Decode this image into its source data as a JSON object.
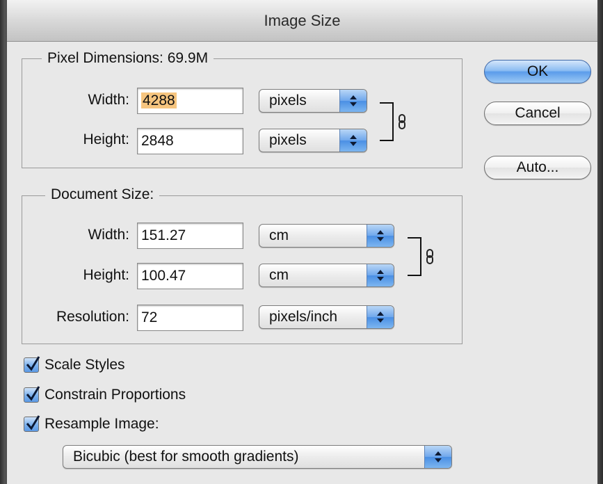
{
  "dialog": {
    "title": "Image Size"
  },
  "pixel_dimensions": {
    "legend": "Pixel Dimensions:  69.9M",
    "width_label": "Width:",
    "width_value": "4288",
    "width_unit": "pixels",
    "height_label": "Height:",
    "height_value": "2848",
    "height_unit": "pixels"
  },
  "document_size": {
    "legend": "Document Size:",
    "width_label": "Width:",
    "width_value": "151.27",
    "width_unit": "cm",
    "height_label": "Height:",
    "height_value": "100.47",
    "height_unit": "cm",
    "resolution_label": "Resolution:",
    "resolution_value": "72",
    "resolution_unit": "pixels/inch"
  },
  "buttons": {
    "ok": "OK",
    "cancel": "Cancel",
    "auto": "Auto..."
  },
  "options": {
    "scale_styles": {
      "label": "Scale Styles",
      "checked": true
    },
    "constrain_proportions": {
      "label": "Constrain Proportions",
      "checked": true
    },
    "resample_image": {
      "label": "Resample Image:",
      "checked": true
    },
    "resample_method": "Bicubic (best for smooth gradients)"
  },
  "icons": {
    "link": "chain-link-icon",
    "popup_arrows": "up-down-arrows-icon",
    "checkmark": "checkmark-icon"
  },
  "colors": {
    "default_button": "#5b9cea",
    "selection_highlight": "#f6c57f",
    "dialog_bg": "#e8e8e8"
  }
}
